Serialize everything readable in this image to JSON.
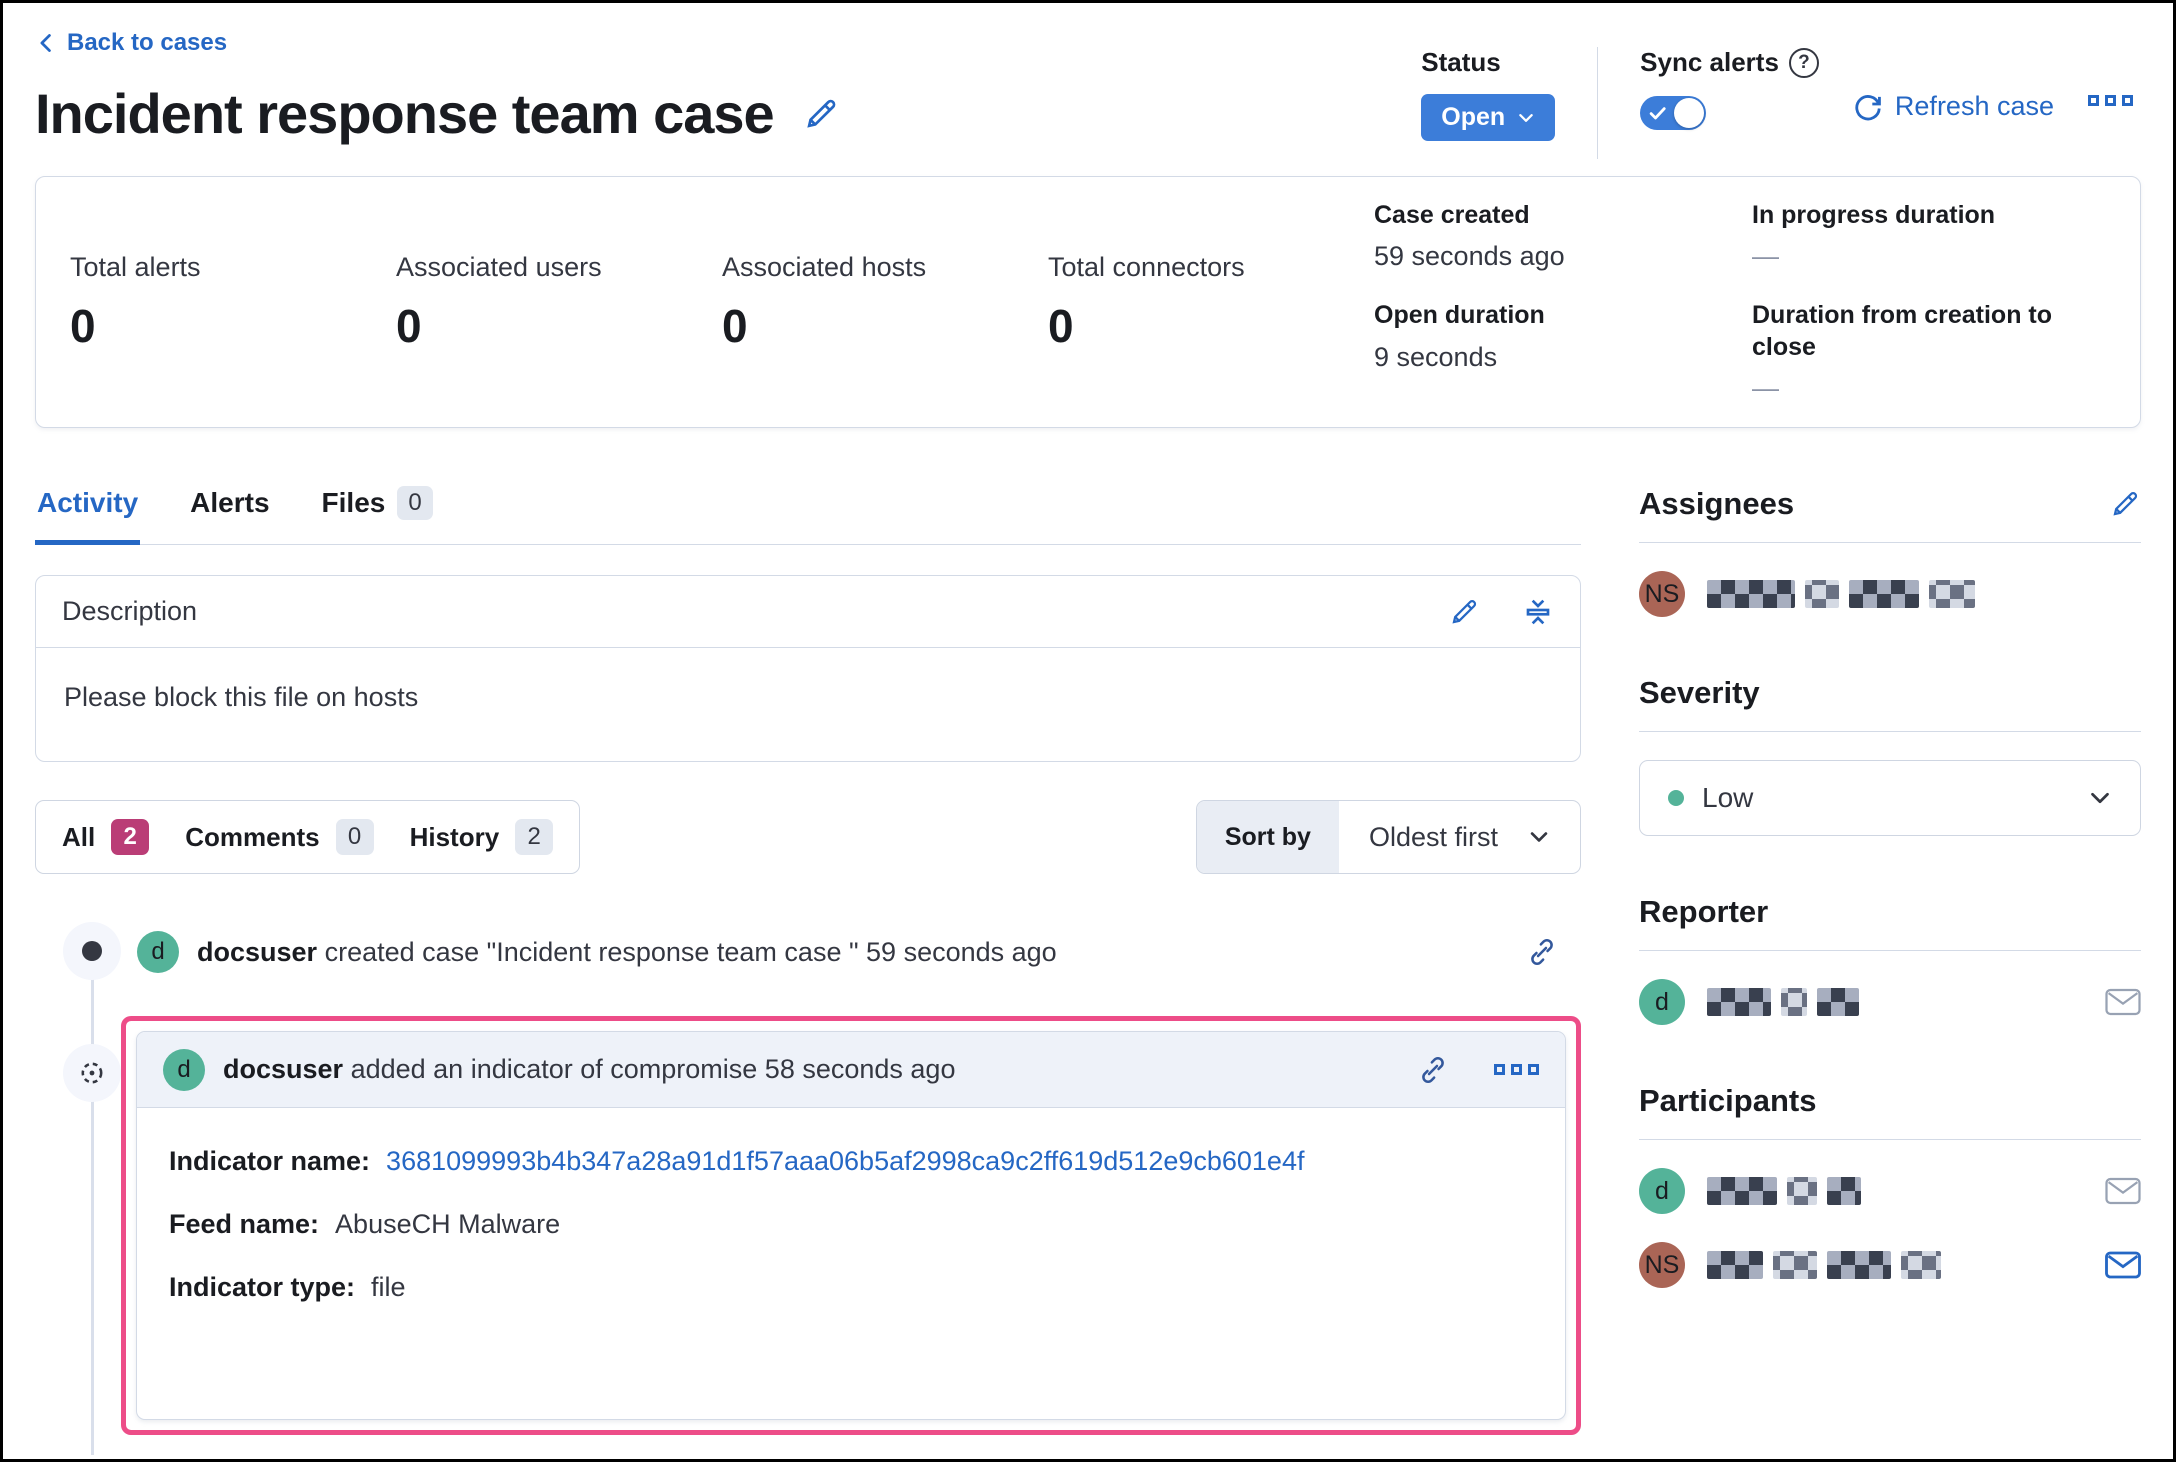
{
  "page": {
    "back_link": "Back to cases",
    "title": "Incident response team case"
  },
  "header_actions": {
    "status_label": "Status",
    "status_value": "Open",
    "sync_alerts_label": "Sync alerts",
    "refresh_label": "Refresh case"
  },
  "summary": {
    "stats": [
      {
        "label": "Total alerts",
        "value": "0"
      },
      {
        "label": "Associated users",
        "value": "0"
      },
      {
        "label": "Associated hosts",
        "value": "0"
      },
      {
        "label": "Total connectors",
        "value": "0"
      }
    ],
    "dates": [
      {
        "label": "Case created",
        "value": "59 seconds ago"
      },
      {
        "label": "Open duration",
        "value": "9 seconds"
      },
      {
        "label": "In progress duration",
        "value": "—"
      },
      {
        "label": "Duration from creation to close",
        "value": "—"
      }
    ]
  },
  "tabs": [
    {
      "label": "Activity"
    },
    {
      "label": "Alerts"
    },
    {
      "label": "Files",
      "badge": "0"
    }
  ],
  "description": {
    "title": "Description",
    "body": "Please block this file on hosts"
  },
  "filters": {
    "all_label": "All",
    "all_count": "2",
    "comments_label": "Comments",
    "comments_count": "0",
    "history_label": "History",
    "history_count": "2",
    "sort_label": "Sort by",
    "sort_value": "Oldest first"
  },
  "timeline": {
    "created_event": {
      "avatar": "d",
      "user": "docsuser",
      "action": "created case \"Incident response team case \" 59 seconds ago"
    },
    "ioc_event": {
      "avatar": "d",
      "user": "docsuser",
      "action": "added an indicator of compromise 58 seconds ago",
      "fields": [
        {
          "label": "Indicator name:",
          "value": "3681099993b4b347a28a91d1f57aaa06b5af2998ca9c2ff619d512e9cb601e4f"
        },
        {
          "label": "Feed name:",
          "value": "AbuseCH Malware"
        },
        {
          "label": "Indicator type:",
          "value": "file"
        }
      ]
    }
  },
  "sidebar": {
    "assignees": {
      "title": "Assignees",
      "users": [
        {
          "initials": "NS",
          "name_redacted": true
        }
      ]
    },
    "severity": {
      "title": "Severity",
      "value": "Low"
    },
    "reporter": {
      "title": "Reporter",
      "users": [
        {
          "initials": "d",
          "name_redacted": true
        }
      ]
    },
    "participants": {
      "title": "Participants",
      "users": [
        {
          "initials": "d",
          "name_redacted": true
        },
        {
          "initials": "NS",
          "name_redacted": true
        }
      ]
    }
  },
  "colors": {
    "primary_blue": "#2567c4",
    "button_blue": "#3c7dd9",
    "highlight_pink": "#ed4d88",
    "badge_pink": "#ba3d76",
    "avatar_green": "#54b399",
    "avatar_brown": "#aa6556",
    "severity_low_dot": "#54b399",
    "border_grey": "#d3dae6"
  }
}
